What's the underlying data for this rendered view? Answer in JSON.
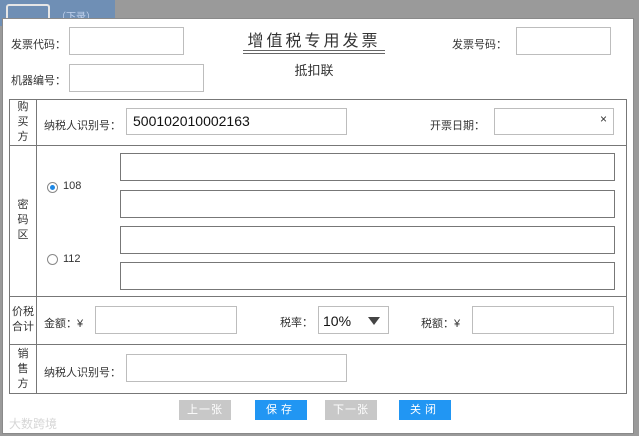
{
  "background": {
    "link_text": "（下录）"
  },
  "header": {
    "invoice_code_label": "发票代码：",
    "invoice_number_label": "发票号码：",
    "machine_number_label": "机器编号：",
    "title": "增值税专用发票",
    "subtitle": "抵扣联"
  },
  "buyer": {
    "section_label": [
      "购",
      "买",
      "方"
    ],
    "taxpayer_id_label": "纳税人识别号：",
    "taxpayer_id_value": "500102010002163",
    "issue_date_label": "开票日期：",
    "clear_symbol": "×"
  },
  "cipher": {
    "section_label": [
      "密",
      "码",
      "区"
    ],
    "options": [
      {
        "label": "108",
        "selected": true
      },
      {
        "label": "112",
        "selected": false
      }
    ]
  },
  "price_tax": {
    "section_label": [
      "价税",
      "合计"
    ],
    "amount_label": "金额：¥",
    "tax_rate_label": "税率：",
    "tax_rate_value": "10%",
    "tax_amount_label": "税额：¥"
  },
  "seller": {
    "section_label": [
      "销",
      "售",
      "方"
    ],
    "taxpayer_id_label": "纳税人识别号："
  },
  "buttons": {
    "prev": "上一张",
    "save": "保存",
    "next": "下一张",
    "close": "关闭"
  },
  "watermark": "大数跨境",
  "colors": {
    "primary": "#2196f3",
    "disabled": "#c8c8c8",
    "border": "#777777"
  }
}
